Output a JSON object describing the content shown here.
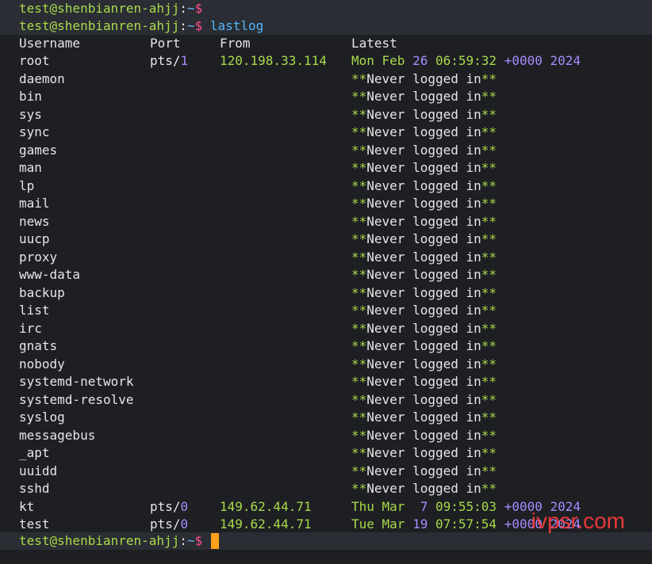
{
  "prompt": {
    "user_host": "test@shenbianren-ahjj",
    "colon": ":",
    "path": "~",
    "dollar": "$"
  },
  "command": "lastlog",
  "headers": {
    "username": "Username",
    "port": "Port",
    "from": "From",
    "latest": "Latest"
  },
  "rows": [
    {
      "username": "root",
      "port_prefix": "pts/",
      "port_num": "1",
      "from": "120.198.33.114",
      "latest": "Mon Feb 26 06:59:32 +0000 2024"
    },
    {
      "username": "daemon",
      "never": "**Never logged in**"
    },
    {
      "username": "bin",
      "never": "**Never logged in**"
    },
    {
      "username": "sys",
      "never": "**Never logged in**"
    },
    {
      "username": "sync",
      "never": "**Never logged in**"
    },
    {
      "username": "games",
      "never": "**Never logged in**"
    },
    {
      "username": "man",
      "never": "**Never logged in**"
    },
    {
      "username": "lp",
      "never": "**Never logged in**"
    },
    {
      "username": "mail",
      "never": "**Never logged in**"
    },
    {
      "username": "news",
      "never": "**Never logged in**"
    },
    {
      "username": "uucp",
      "never": "**Never logged in**"
    },
    {
      "username": "proxy",
      "never": "**Never logged in**"
    },
    {
      "username": "www-data",
      "never": "**Never logged in**"
    },
    {
      "username": "backup",
      "never": "**Never logged in**"
    },
    {
      "username": "list",
      "never": "**Never logged in**"
    },
    {
      "username": "irc",
      "never": "**Never logged in**"
    },
    {
      "username": "gnats",
      "never": "**Never logged in**"
    },
    {
      "username": "nobody",
      "never": "**Never logged in**"
    },
    {
      "username": "systemd-network",
      "never": "**Never logged in**"
    },
    {
      "username": "systemd-resolve",
      "never": "**Never logged in**"
    },
    {
      "username": "syslog",
      "never": "**Never logged in**"
    },
    {
      "username": "messagebus",
      "never": "**Never logged in**"
    },
    {
      "username": "_apt",
      "never": "**Never logged in**"
    },
    {
      "username": "uuidd",
      "never": "**Never logged in**"
    },
    {
      "username": "sshd",
      "never": "**Never logged in**"
    },
    {
      "username": "kt",
      "port_prefix": "pts/",
      "port_num": "0",
      "from": "149.62.44.71",
      "latest": "Thu Mar  7 09:55:03 +0000 2024"
    },
    {
      "username": "test",
      "port_prefix": "pts/",
      "port_num": "0",
      "from": "149.62.44.71",
      "latest": "Tue Mar 19 07:57:54 +0000 2024"
    }
  ],
  "watermark": "ivpsr.com",
  "colors": {
    "background": "#1d1f23",
    "highlight_row": "#2a2d33",
    "green": "#a9d94a",
    "purple": "#a98bff",
    "prompt_dollar": "#ff4f8a",
    "command": "#53b6ff",
    "cursor": "#ff9f1a"
  }
}
